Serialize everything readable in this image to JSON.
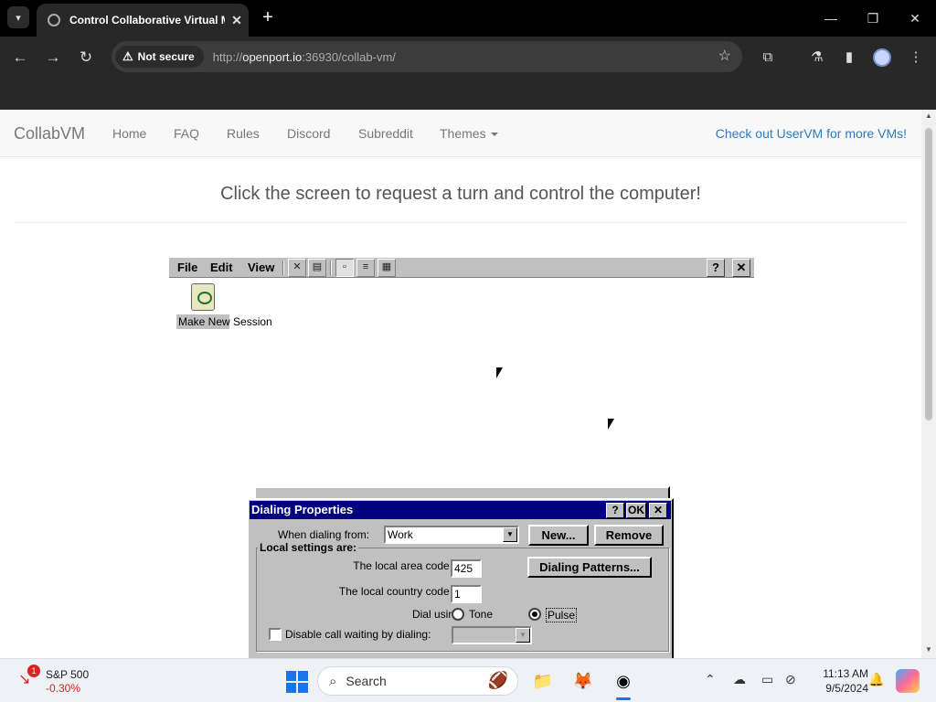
{
  "browser": {
    "tab_title": "Control Collaborative Virtual M",
    "tab_close": "✕",
    "new_tab": "+",
    "security_label": "Not secure",
    "url_scheme": "http://",
    "url_host": "openport.io",
    "url_path": ":36930/collab-vm/",
    "window_controls": {
      "minimize": "—",
      "maximize": "❐",
      "close": "✕"
    },
    "icons": [
      "back-arrow-icon",
      "forward-arrow-icon",
      "reload-icon",
      "star-icon",
      "extensions-icon",
      "labs-icon",
      "sidebar-icon",
      "profile-icon",
      "menu-icon"
    ]
  },
  "site": {
    "brand": "CollabVM",
    "nav": [
      "Home",
      "FAQ",
      "Rules",
      "Discord",
      "Subreddit",
      "Themes"
    ],
    "right_link": "Check out UserVM for more VMs!",
    "headline": "Click the screen to request a turn and control the computer!"
  },
  "vm": {
    "menus": [
      "File",
      "Edit",
      "View"
    ],
    "toolbar_help": "?",
    "toolbar_close": "✕",
    "desktop_icon_label": "Make New Session",
    "dialog": {
      "title": "Dialing Properties",
      "title_buttons": {
        "help": "?",
        "ok": "OK",
        "close": "✕"
      },
      "when_dialing_from_label": "When dialing from:",
      "when_dialing_from_value": "Work",
      "new_button": "New...",
      "remove_button": "Remove",
      "local_settings_legend": "Local settings are:",
      "area_code_label": "The local area code is:",
      "area_code_value": "425",
      "country_code_label": "The local country code is:",
      "country_code_value": "1",
      "dialing_patterns_button": "Dialing Patterns...",
      "dial_using_label": "Dial using:",
      "tone_label": "Tone",
      "pulse_label": "Pulse",
      "dial_using_selected": "Pulse",
      "disable_call_waiting_label": "Disable call waiting by dialing:",
      "disable_call_waiting_checked": false
    }
  },
  "taskbar": {
    "stock_badge": "1",
    "stock_name": "S&P 500",
    "stock_change": "-0.30%",
    "search_placeholder": "Search",
    "time": "11:13 AM",
    "date": "9/5/2024",
    "colors": {
      "stock_down": "#c42b1c",
      "accent": "#1a73e8"
    }
  }
}
